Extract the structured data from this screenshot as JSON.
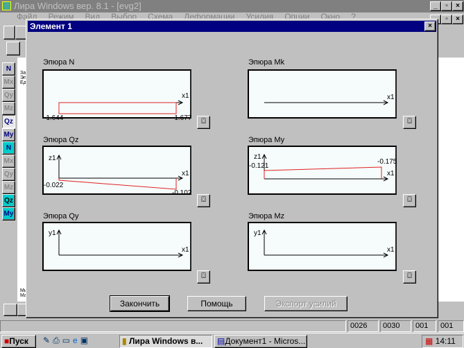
{
  "app": {
    "title": "Лира Windows  вер. 8.1 - [evg2]",
    "menu": [
      "Файл",
      "Режим",
      "Вид",
      "Выбор",
      "Схема",
      "Деформации",
      "Усилия",
      "Опции",
      "Окно",
      "?"
    ]
  },
  "toolbar_left": [
    "N",
    "Mx",
    "Qy",
    "Mz",
    "Qz",
    "My",
    "N",
    "Mx",
    "Qy",
    "Mz",
    "Qz",
    "My"
  ],
  "side_text": [
    "Заг",
    "Эп",
    "Ед",
    "Ми",
    "Ма"
  ],
  "dialog": {
    "title": "Элемент 1",
    "close": "×",
    "panels": [
      {
        "title": "Эпюра N",
        "axis_x": "x1",
        "axis_y": "",
        "values": [
          "-1.644",
          "-1.677"
        ]
      },
      {
        "title": "Эпюра Mk",
        "axis_x": "x1",
        "axis_y": "",
        "values": []
      },
      {
        "title": "Эпюра Qz",
        "axis_x": "x1",
        "axis_y": "z1",
        "values": [
          "-0.022",
          "-0.102"
        ]
      },
      {
        "title": "Эпюра My",
        "axis_x": "x1",
        "axis_y": "z1",
        "values": [
          "-0.121",
          "-0.175"
        ]
      },
      {
        "title": "Эпюра Qy",
        "axis_x": "x1",
        "axis_y": "y1",
        "values": []
      },
      {
        "title": "Эпюра Mz",
        "axis_x": "x1",
        "axis_y": "y1",
        "values": []
      }
    ],
    "buttons": {
      "finish": "Закончить",
      "help": "Помощь",
      "export": "Экспорт усилий"
    }
  },
  "statusbar": [
    "0026",
    "0030",
    "001",
    "001"
  ],
  "taskbar": {
    "start": "Пуск",
    "tasks": [
      "Лира Windows  в...",
      "Документ1 - Micros..."
    ],
    "clock": "14:11"
  },
  "colors": {
    "titlebar_active": "#000080",
    "diagram_line": "#e02020"
  }
}
